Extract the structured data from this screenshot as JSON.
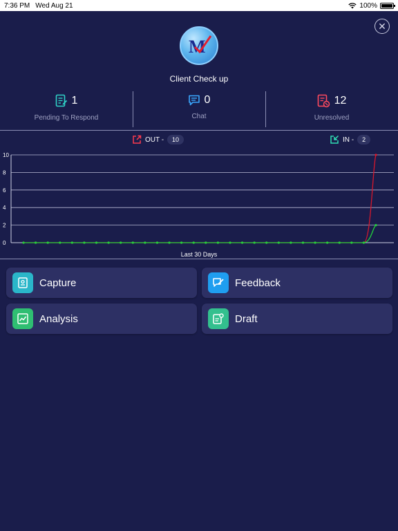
{
  "status_bar": {
    "time": "7:36 PM",
    "date": "Wed Aug 21",
    "battery": "100%"
  },
  "header": {
    "title": "Client Check up",
    "logo_letter": "M"
  },
  "stats": [
    {
      "value": "1",
      "label": "Pending To Respond",
      "icon": "document-edit-icon",
      "color": "#2fd3c7"
    },
    {
      "value": "0",
      "label": "Chat",
      "icon": "chat-bubble-icon",
      "color": "#3aa8ff"
    },
    {
      "value": "12",
      "label": "Unresolved",
      "icon": "document-alert-icon",
      "color": "#ff4a5e"
    }
  ],
  "legend": {
    "out": {
      "label": "OUT -",
      "count": "10",
      "color": "#ff3b4e"
    },
    "in": {
      "label": "IN -",
      "count": "2",
      "color": "#2fe0b4"
    }
  },
  "chart_data": {
    "type": "line",
    "xlabel": "Last 30 Days",
    "ylim": [
      0,
      10
    ],
    "yticks": [
      "0",
      "2",
      "4",
      "6",
      "8",
      "10"
    ],
    "grid": true,
    "x": [
      1,
      2,
      3,
      4,
      5,
      6,
      7,
      8,
      9,
      10,
      11,
      12,
      13,
      14,
      15,
      16,
      17,
      18,
      19,
      20,
      21,
      22,
      23,
      24,
      25,
      26,
      27,
      28,
      29,
      30
    ],
    "series": [
      {
        "name": "OUT",
        "color": "#d8182c",
        "values": [
          0,
          0,
          0,
          0,
          0,
          0,
          0,
          0,
          0,
          0,
          0,
          0,
          0,
          0,
          0,
          0,
          0,
          0,
          0,
          0,
          0,
          0,
          0,
          0,
          0,
          0,
          0,
          0,
          0,
          10
        ]
      },
      {
        "name": "IN",
        "color": "#22d43c",
        "values": [
          0,
          0,
          0,
          0,
          0,
          0,
          0,
          0,
          0,
          0,
          0,
          0,
          0,
          0,
          0,
          0,
          0,
          0,
          0,
          0,
          0,
          0,
          0,
          0,
          0,
          0,
          0,
          0,
          0,
          2
        ]
      }
    ]
  },
  "tiles": [
    {
      "label": "Capture",
      "icon": "capture-icon",
      "color": "#2ab6c9"
    },
    {
      "label": "Feedback",
      "icon": "feedback-icon",
      "color": "#1f9ef0"
    },
    {
      "label": "Analysis",
      "icon": "analysis-icon",
      "color": "#2fbe72"
    },
    {
      "label": "Draft",
      "icon": "draft-icon",
      "color": "#33c08e"
    }
  ]
}
